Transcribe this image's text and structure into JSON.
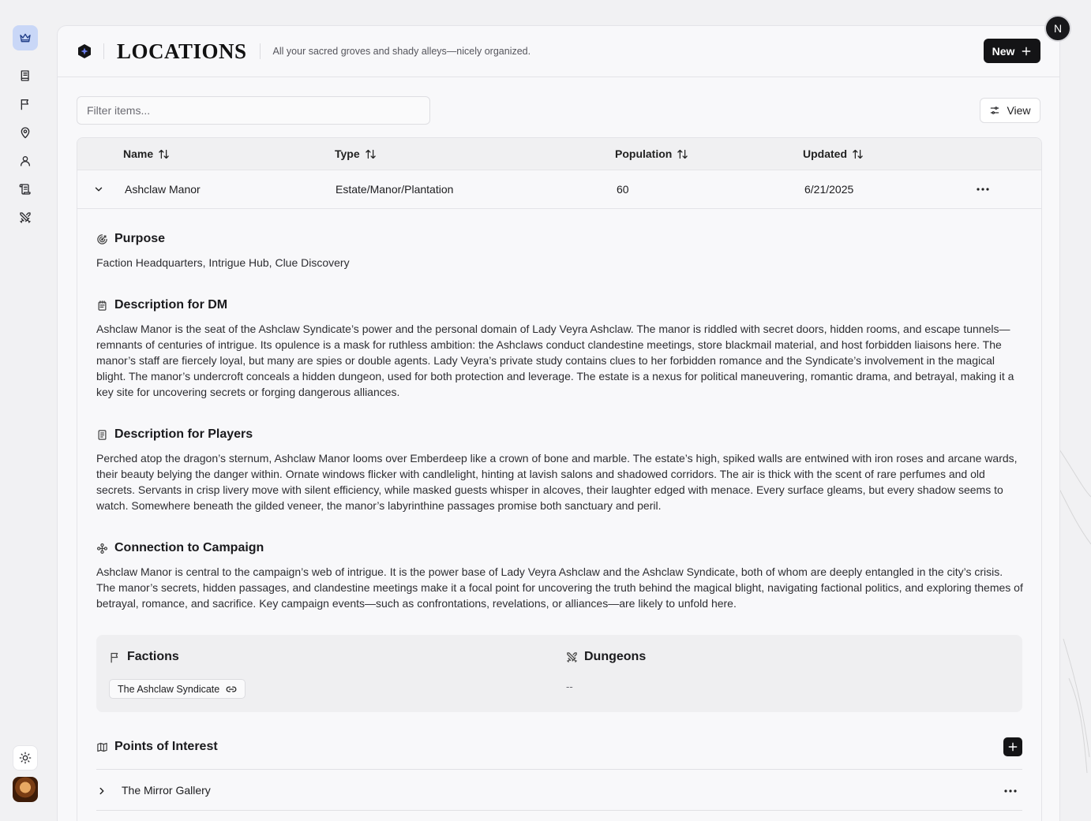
{
  "app": {
    "page_title": "LOCATIONS",
    "subtitle": "All your sacred groves and shady alleys—nicely organized.",
    "new_label": "New",
    "user_initial": "N"
  },
  "rail": {
    "items": [
      {
        "name": "crown-icon"
      },
      {
        "name": "book-icon"
      },
      {
        "name": "flag-icon"
      },
      {
        "name": "map-pin-icon"
      },
      {
        "name": "user-icon"
      },
      {
        "name": "scroll-icon"
      },
      {
        "name": "swords-icon"
      }
    ],
    "theme_icon": "sun-icon"
  },
  "toolbar": {
    "filter_placeholder": "Filter items...",
    "view_label": "View"
  },
  "table": {
    "columns": [
      "Name",
      "Type",
      "Population",
      "Updated"
    ],
    "rows": [
      {
        "name": "Ashclaw Manor",
        "type": "Estate/Manor/Plantation",
        "population": "60",
        "updated": "6/21/2025",
        "expanded": true
      }
    ]
  },
  "detail": {
    "purpose": {
      "heading": "Purpose",
      "text": "Faction Headquarters, Intrigue Hub, Clue Discovery"
    },
    "dm": {
      "heading": "Description for DM",
      "text": "Ashclaw Manor is the seat of the Ashclaw Syndicate’s power and the personal domain of Lady Veyra Ashclaw. The manor is riddled with secret doors, hidden rooms, and escape tunnels—remnants of centuries of intrigue. Its opulence is a mask for ruthless ambition: the Ashclaws conduct clandestine meetings, store blackmail material, and host forbidden liaisons here. The manor’s staff are fiercely loyal, but many are spies or double agents. Lady Veyra’s private study contains clues to her forbidden romance and the Syndicate’s involvement in the magical blight. The manor’s undercroft conceals a hidden dungeon, used for both protection and leverage. The estate is a nexus for political maneuvering, romantic drama, and betrayal, making it a key site for uncovering secrets or forging dangerous alliances."
    },
    "players": {
      "heading": "Description for Players",
      "text": "Perched atop the dragon’s sternum, Ashclaw Manor looms over Emberdeep like a crown of bone and marble. The estate’s high, spiked walls are entwined with iron roses and arcane wards, their beauty belying the danger within. Ornate windows flicker with candlelight, hinting at lavish salons and shadowed corridors. The air is thick with the scent of rare perfumes and old secrets. Servants in crisp livery move with silent efficiency, while masked guests whisper in alcoves, their laughter edged with menace. Every surface gleams, but every shadow seems to watch. Somewhere beneath the gilded veneer, the manor’s labyrinthine passages promise both sanctuary and peril."
    },
    "campaign": {
      "heading": "Connection to Campaign",
      "text": "Ashclaw Manor is central to the campaign’s web of intrigue. It is the power base of Lady Veyra Ashclaw and the Ashclaw Syndicate, both of whom are deeply entangled in the city’s crisis. The manor’s secrets, hidden passages, and clandestine meetings make it a focal point for uncovering the truth behind the magical blight, navigating factional politics, and exploring themes of betrayal, romance, and sacrifice. Key campaign events—such as confrontations, revelations, or alliances—are likely to unfold here."
    },
    "factions": {
      "heading": "Factions",
      "items": [
        "The Ashclaw Syndicate"
      ]
    },
    "dungeons": {
      "heading": "Dungeons",
      "empty": "--"
    },
    "poi": {
      "heading": "Points of Interest",
      "items": [
        "The Mirror Gallery"
      ]
    }
  }
}
